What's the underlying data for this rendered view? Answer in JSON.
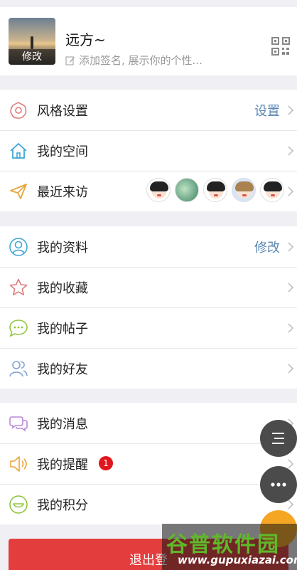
{
  "profile": {
    "avatar_edit": "修改",
    "username": "远方~",
    "signature_placeholder": "添加签名, 展示你的个性..."
  },
  "group1": [
    {
      "label": "风格设置",
      "value": "设置",
      "icon": "flower-icon"
    },
    {
      "label": "我的空间",
      "value": "",
      "icon": "home-icon"
    },
    {
      "label": "最近来访",
      "value": "",
      "icon": "paper-plane-icon"
    }
  ],
  "group2": [
    {
      "label": "我的资料",
      "value": "修改",
      "icon": "user-icon"
    },
    {
      "label": "我的收藏",
      "value": "",
      "icon": "star-icon"
    },
    {
      "label": "我的帖子",
      "value": "",
      "icon": "chat-bubble-icon"
    },
    {
      "label": "我的好友",
      "value": "",
      "icon": "friends-icon"
    }
  ],
  "group3": [
    {
      "label": "我的消息",
      "value": "",
      "icon": "messages-icon"
    },
    {
      "label": "我的提醒",
      "badge": "1",
      "icon": "speaker-icon"
    },
    {
      "label": "我的积分",
      "value": "",
      "icon": "smile-icon"
    }
  ],
  "logout_label": "退出登",
  "watermark": {
    "title": "谷普软件园",
    "url": "www.gupuxiazai.com"
  },
  "colors": {
    "accent": "#5a87b3",
    "logout": "#e33d3d",
    "badge": "#e0161c"
  }
}
